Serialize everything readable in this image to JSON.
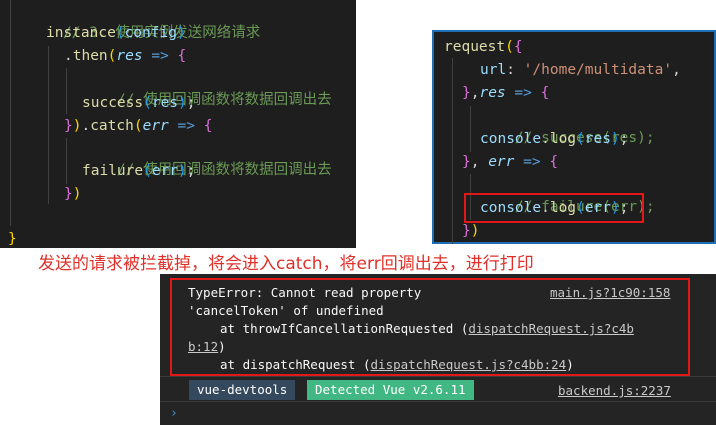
{
  "editor_left": {
    "comment_top": "// 3. 使用实例发送网络请求",
    "instance_fn": "instance",
    "instance_arg": "config",
    "then_fn": "then",
    "then_param": "res",
    "comment_then": "// 使用回调函数将数据回调出去",
    "success_fn": "success",
    "success_arg": "res",
    "catch_fn": "catch",
    "catch_param": "err",
    "comment_catch": "// 使用回调函数将数据回调出去",
    "failure_fn": "failure",
    "failure_arg": "err"
  },
  "editor_right": {
    "request_fn": "request",
    "url_key": "url",
    "url_value": "'/home/multidata'",
    "res_param": "res",
    "comment_success": "// success(res);",
    "console_obj": "console",
    "log_fn": "log",
    "log_res_arg": "res",
    "err_param": "err",
    "comment_failure": "// failure(err);",
    "log_err_arg": "err"
  },
  "caption": "发送的请求被拦截掉，将会进入catch，将err回调出去，进行打印",
  "console": {
    "error_line1": "TypeError: Cannot read property",
    "error_source": "main.js?1c90:158",
    "error_line2": "'cancelToken' of undefined",
    "stack1_prefix": "at throwIfCancellationRequested (",
    "stack1_link": "dispatchRequest.js?c4b",
    "stack1_link_cont": "b:12",
    "stack1_suffix": ")",
    "stack2_prefix": "at dispatchRequest (",
    "stack2_link": "dispatchRequest.js?c4bb:24",
    "stack2_suffix": ")",
    "devtools_tag": "vue-devtools",
    "detected_tag": "Detected Vue v2.6.11",
    "backend_source": "backend.js:2237",
    "prompt": "›"
  },
  "colors": {
    "tag_devtools_bg": "#35495e",
    "tag_detected_bg": "#41b883",
    "annotation_red": "#e01818"
  }
}
